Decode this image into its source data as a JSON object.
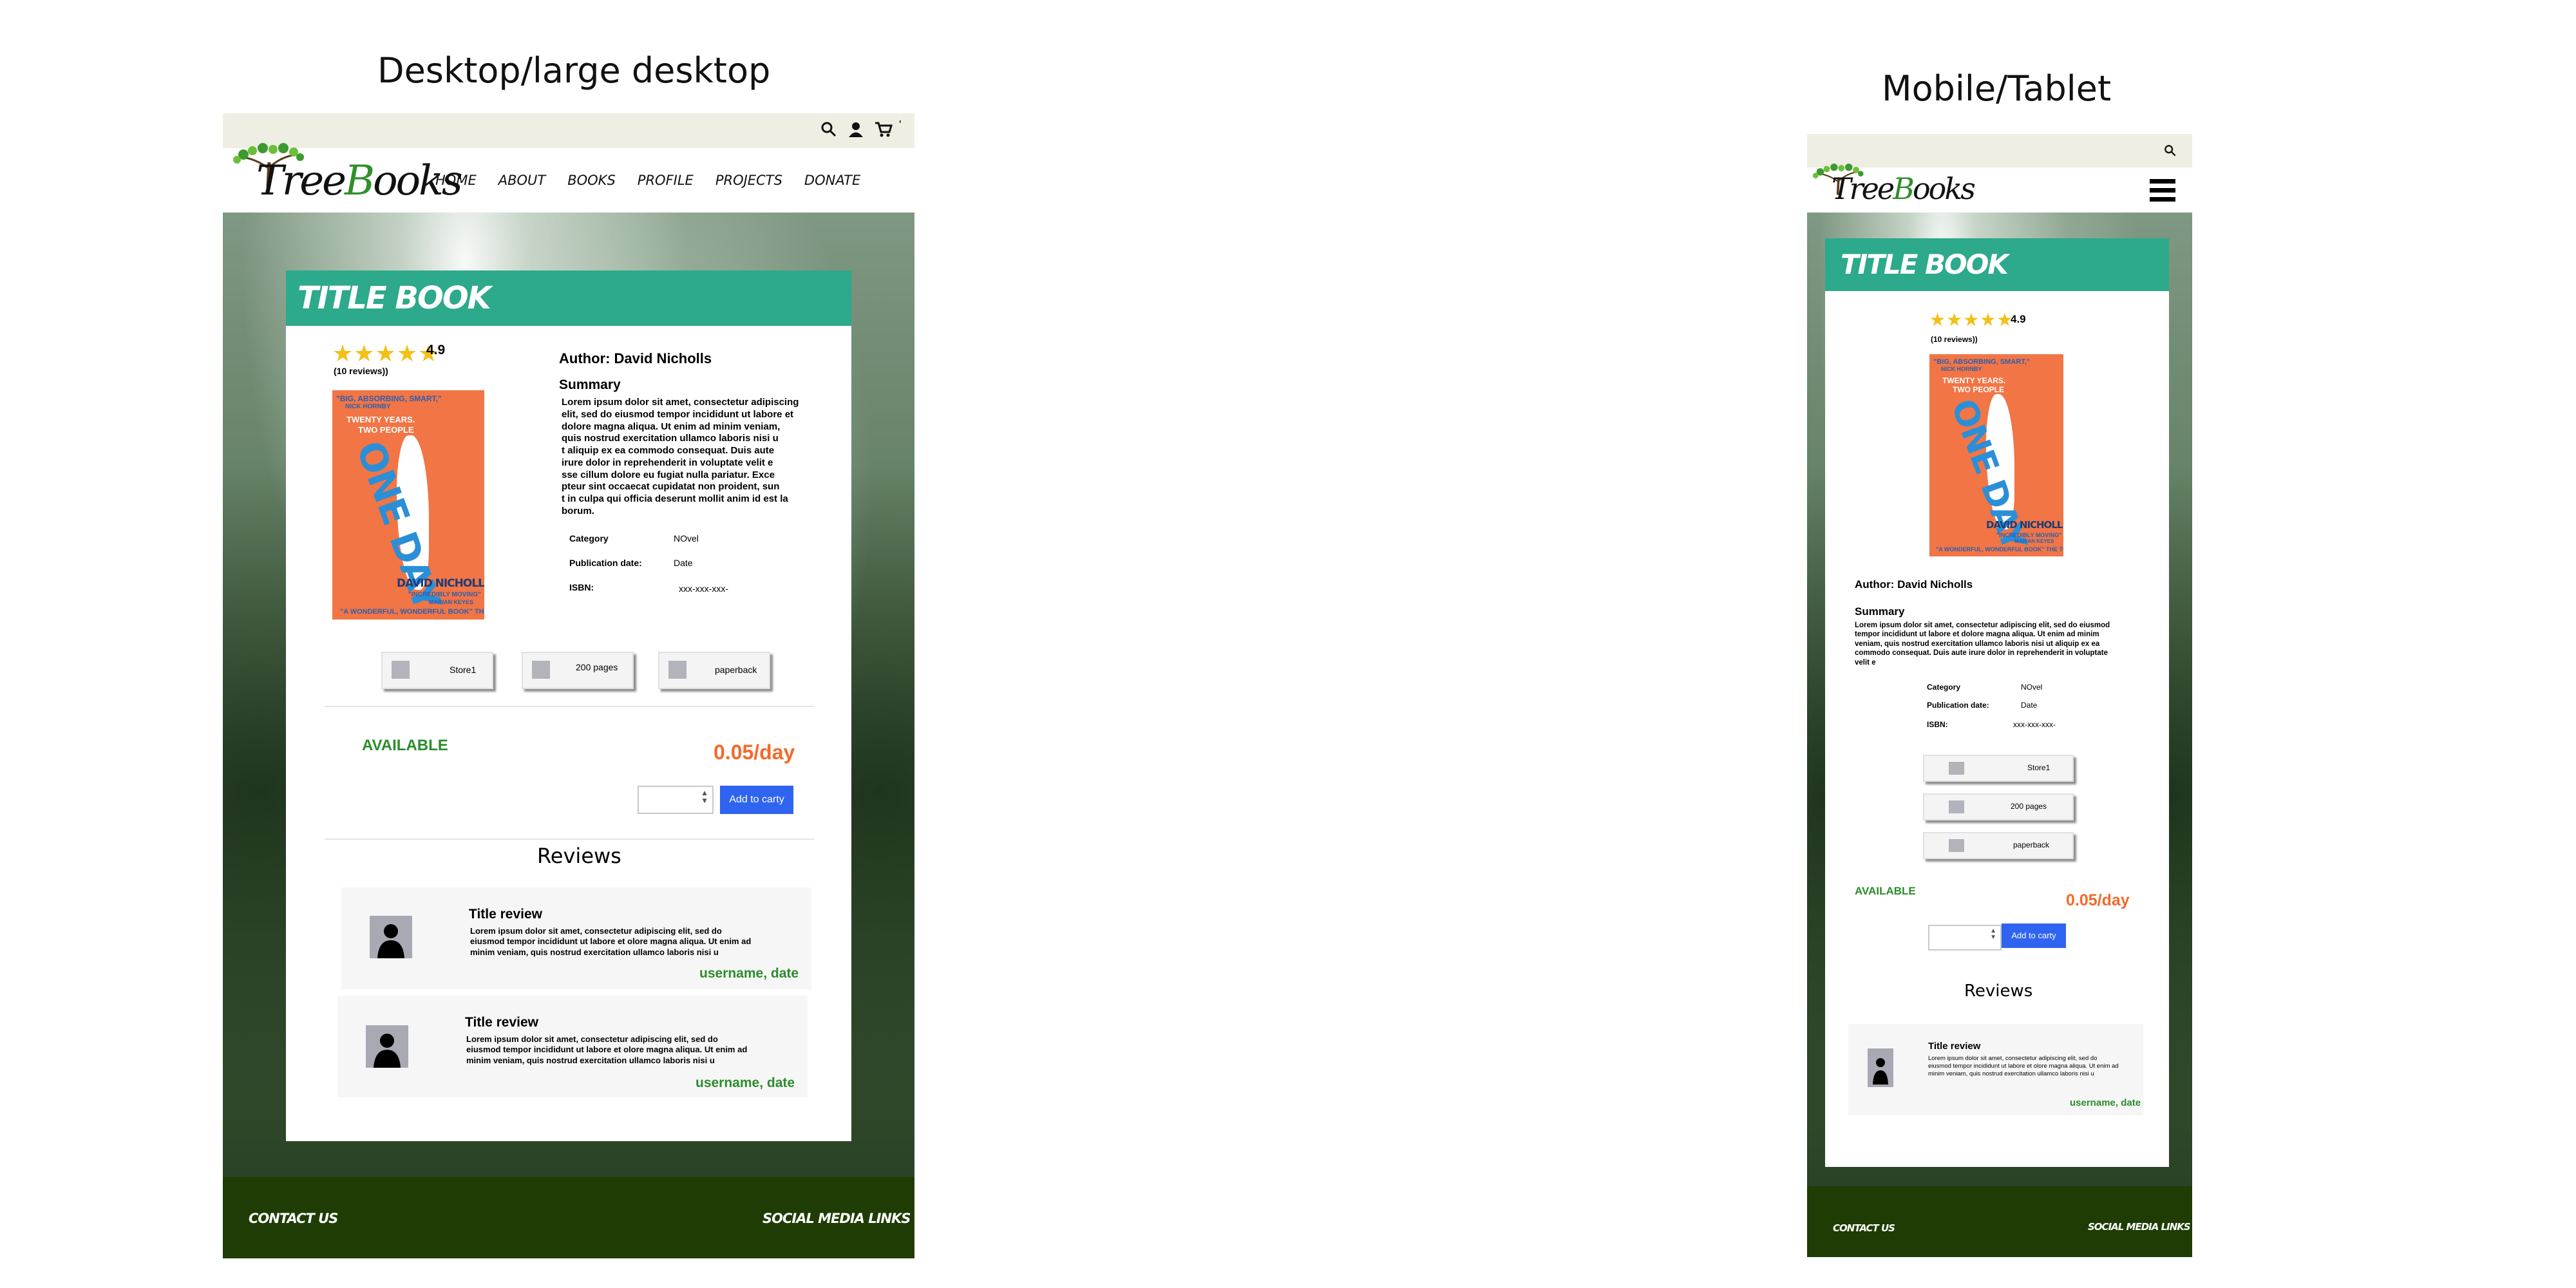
{
  "headings": {
    "desktop": "Desktop/large desktop",
    "mobile": "Mobile/Tablet"
  },
  "brand": {
    "logo_prefix": "Tree",
    "logo_b": "B",
    "logo_suffix": "ooks"
  },
  "nav": {
    "items": [
      "HOME",
      "ABOUT",
      "BOOKS",
      "PROFILE",
      "PROJECTS",
      "DONATE"
    ]
  },
  "topbar": {
    "extra": "'"
  },
  "book": {
    "title": "TITLE BOOK",
    "rating": "4.9",
    "stars": "★★★★★",
    "reviews_count": "(10 reviews))",
    "author": "Author: David Nicholls",
    "summary_label": "Summary",
    "summary_desktop_lines": [
      "Lorem ipsum dolor sit amet, consectetur adipiscing",
      "elit, sed do eiusmod tempor incididunt ut labore et",
      "dolore magna aliqua. Ut enim ad minim veniam,",
      " quis nostrud exercitation ullamco laboris nisi u",
      "t aliquip ex ea commodo consequat. Duis aute",
      " irure dolor in reprehenderit in voluptate velit e",
      "sse cillum dolore eu fugiat nulla pariatur. Exce",
      "pteur sint occaecat cupidatat non proident, sun",
      "t in culpa qui officia deserunt mollit anim id est la",
      "borum."
    ],
    "summary_mobile_lines": [
      "Lorem ipsum dolor sit amet, consectetur adipiscing elit, sed do eiusmod",
      " tempor incididunt ut labore et dolore magna aliqua. Ut enim ad minim",
      "veniam, quis nostrud exercitation ullamco laboris nisi ut aliquip ex ea",
      "commodo consequat. Duis aute irure dolor in reprehenderit in voluptate",
      "velit e"
    ],
    "category_label": "Category",
    "category_value": "NOvel",
    "pubdate_label": "Publication date:",
    "pubdate_value": "Date",
    "isbn_label": "ISBN:",
    "isbn_value": "xxx-xxx-xxx-",
    "tiles": [
      "Store1",
      "200 pages",
      "paperback"
    ],
    "available": "AVAILABLE",
    "price": "0.05/day",
    "add_to_cart": "Add to carty",
    "cover": {
      "quote_top1": "\"BIG, ABSORBING, SMART,\"",
      "quote_top2": "NICK HORNBY",
      "tagline1": "TWENTY YEARS.",
      "tagline2": "TWO PEOPLE",
      "title": "ONE DAY",
      "author": "DAVID NICHOLLS",
      "quote_bottom1": "\"INCREDIBLY MOVING\"",
      "quote_bottom2": "MARIAN KEYES",
      "quote_bottom3": "\"A WONDERFUL, WONDERFUL BOOK\" THE TIMES"
    }
  },
  "reviews": {
    "heading": "Reviews",
    "items": [
      {
        "title": "Title review",
        "lines": [
          "Lorem ipsum dolor sit amet, consectetur adipiscing elit, sed do",
          "eiusmod tempor incididunt ut labore et olore magna aliqua. Ut enim ad",
          " minim veniam, quis nostrud exercitation ullamco laboris nisi u"
        ],
        "meta": "username, date"
      },
      {
        "title": "Title review",
        "lines": [
          "Lorem ipsum dolor sit amet, consectetur adipiscing elit, sed do",
          "eiusmod tempor incididunt ut labore et olore magna aliqua. Ut enim ad",
          " minim veniam, quis nostrud exercitation ullamco laboris nisi u"
        ],
        "meta": "username, date"
      }
    ],
    "mobile_item": {
      "title": "Title review",
      "lines": [
        "Lorem ipsum dolor sit amet, consectetur adipiscing elit, sed do",
        "eiusmod tempor incididunt ut labore et olore magna aliqua. Ut enim ad",
        " minim veniam, quis nostrud exercitation ullamco laboris nisi u"
      ],
      "meta": "username, date"
    }
  },
  "footer": {
    "contact": "CONTACT US",
    "social": "SOCIAL MEDIA LINKS"
  },
  "colors": {
    "accent_green": "#2da98b",
    "footer_green": "#1e3c03",
    "price_orange": "#f26a2d",
    "available_green": "#2b8c2b",
    "button_blue": "#2f64f0",
    "topbar": "#eeeee2"
  },
  "icons": {
    "search": "search-icon",
    "user": "user-icon",
    "cart": "cart-icon",
    "menu": "hamburger-menu-icon",
    "avatar": "avatar-icon",
    "star": "star-icon"
  }
}
